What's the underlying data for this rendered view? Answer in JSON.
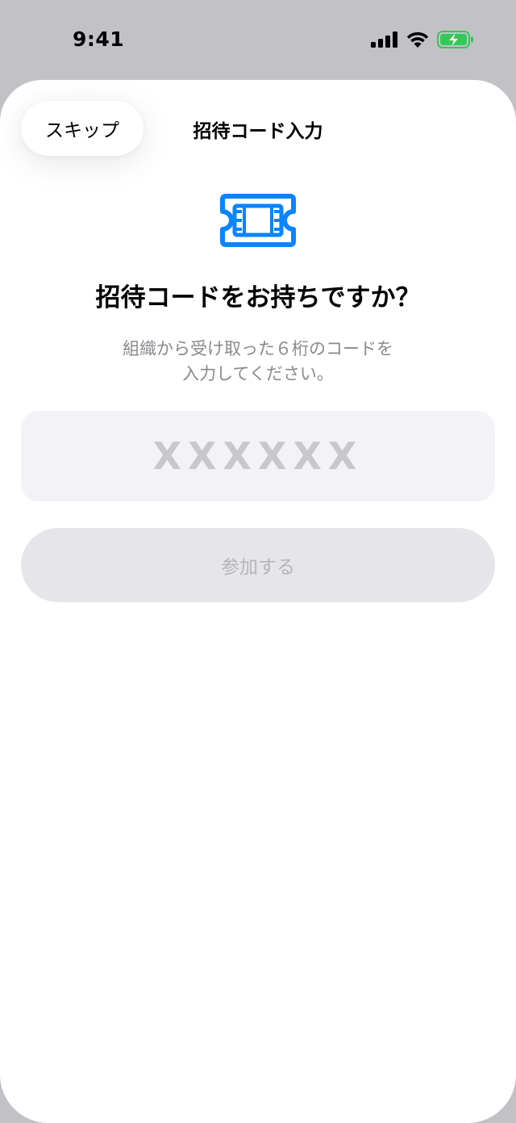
{
  "status_bar": {
    "time": "9:41",
    "icons": [
      "cellular-signal-icon",
      "wifi-icon",
      "battery-charging-icon"
    ],
    "battery_color": "#34c759"
  },
  "nav": {
    "skip_label": "スキップ",
    "title": "招待コード入力"
  },
  "content": {
    "icon": "ticket-icon",
    "icon_color": "#0a84ff",
    "headline": "招待コードをお持ちですか？",
    "description_line1": "組織から受け取った６桁のコードを",
    "description_line2": "入力してください。"
  },
  "code_field": {
    "value": "",
    "placeholder": "XXXXXX"
  },
  "join_button": {
    "label": "参加する",
    "enabled": false
  }
}
